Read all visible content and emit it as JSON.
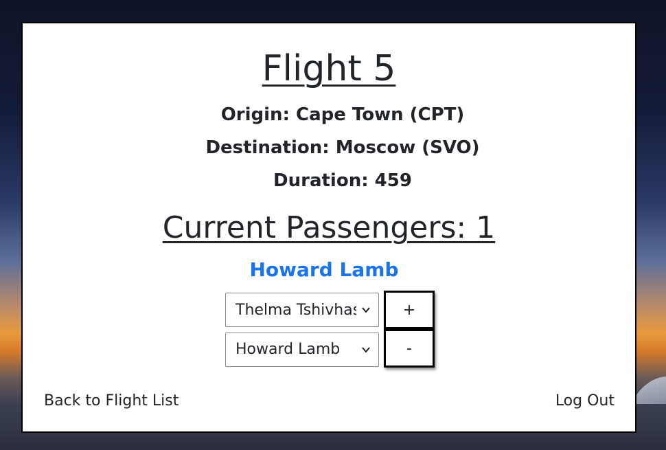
{
  "flight": {
    "title": "Flight 5",
    "origin": "Origin: Cape Town (CPT)",
    "destination": "Destination: Moscow (SVO)",
    "duration": "Duration: 459"
  },
  "passengers": {
    "heading": "Current Passengers: 1",
    "list": [
      "Howard Lamb"
    ]
  },
  "add_passenger": {
    "selected": "Thelma Tshivhase",
    "button_label": "+"
  },
  "remove_passenger": {
    "selected": "Howard Lamb",
    "button_label": "-"
  },
  "footer": {
    "back_label": "Back to Flight List",
    "logout_label": "Log Out"
  },
  "colors": {
    "link": "#1a73e8",
    "text": "#212529"
  }
}
